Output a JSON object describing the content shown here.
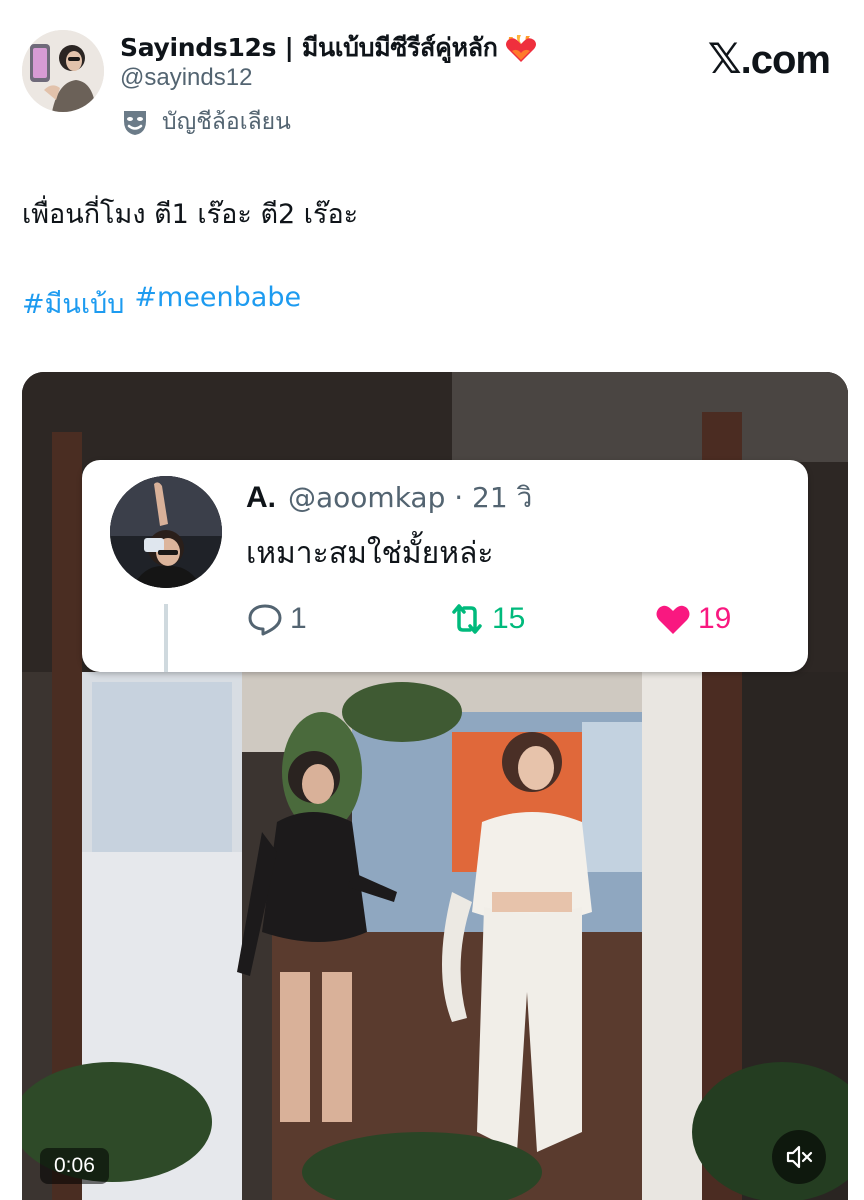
{
  "author": {
    "display_name": "Sayinds12s | มีนเบ้บมีซีรีส์คู่หลัก",
    "handle": "@sayinds12",
    "badge_icon": "heart-on-fire-icon",
    "parody_label": "บัญชีล้อเลียน",
    "parody_icon": "theater-mask-icon"
  },
  "brand": {
    "label": ".com",
    "mark": "𝕏"
  },
  "tweet": {
    "text": "เพื่อนกี่โมง ตี1 เร๊อะ ตี2 เร๊อะ",
    "hashtags": [
      "#มีนเบ้บ",
      "#meenbabe"
    ]
  },
  "quote": {
    "name": "A.",
    "meta": "@aoomkap · 21 วิ",
    "text": "เหมาะสมใช่มั้ยหล่ะ",
    "reply_count": "1",
    "retweet_count": "15",
    "like_count": "19"
  },
  "video": {
    "timestamp": "0:06",
    "mute_icon": "speaker-muted-icon"
  },
  "colors": {
    "link": "#1d9bf0",
    "retweet": "#00ba7c",
    "like": "#f91880",
    "secondary_text": "#536471"
  }
}
